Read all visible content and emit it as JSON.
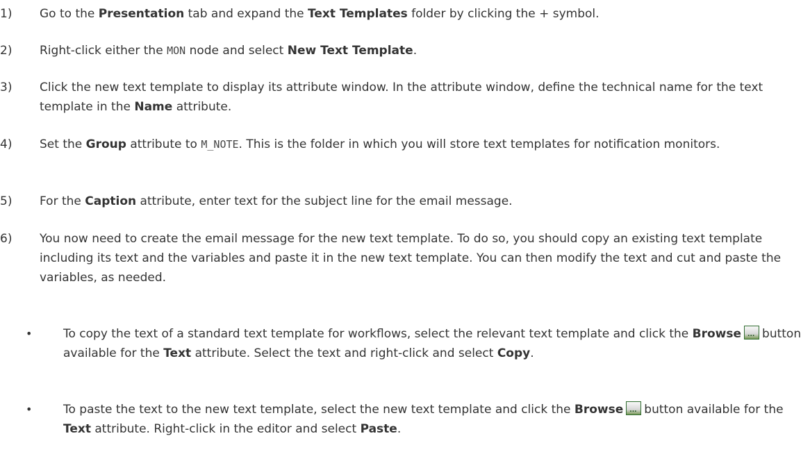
{
  "steps": [
    {
      "num": "1)",
      "parts": [
        {
          "t": "Go to the "
        },
        {
          "b": "Presentation"
        },
        {
          "t": " tab and expand the "
        },
        {
          "b": "Text Templates"
        },
        {
          "t": " folder by clicking the + symbol."
        }
      ]
    },
    {
      "num": "2)",
      "parts": [
        {
          "t": "Right-click either the "
        },
        {
          "m": "MON"
        },
        {
          "t": " node and select "
        },
        {
          "b": "New Text Template"
        },
        {
          "t": "."
        }
      ]
    },
    {
      "num": "3)",
      "parts": [
        {
          "t": "Click the new text template to display its attribute window. In the attribute window, define the technical name for the text template in the "
        },
        {
          "b": "Name"
        },
        {
          "t": " attribute."
        }
      ]
    },
    {
      "num": "4)",
      "parts": [
        {
          "t": "Set the "
        },
        {
          "b": "Group"
        },
        {
          "t": " attribute to "
        },
        {
          "m": "M_NOTE"
        },
        {
          "t": ". This is the folder in which you will store text templates for notification monitors."
        }
      ]
    },
    {
      "num": "5)",
      "parts": [
        {
          "t": "For the "
        },
        {
          "b": "Caption"
        },
        {
          "t": " attribute, enter text for the subject line for the email message."
        }
      ]
    },
    {
      "num": "6)",
      "parts": [
        {
          "t": "You now need to create the email message for the new text template. To do so, you should copy an existing text template including its text and the variables and paste it in the new text template. You can then modify the text and cut and paste the variables, as needed."
        }
      ]
    }
  ],
  "bullets": [
    {
      "dot": "•",
      "parts": [
        {
          "t": "To copy the text of a standard text template for workflows, select the relevant text template and click the "
        },
        {
          "b": "Browse"
        },
        {
          "icon": "browse-icon"
        },
        {
          "t": "button available for the "
        },
        {
          "b": "Text"
        },
        {
          "t": " attribute. Select the text and right-click and select "
        },
        {
          "b": "Copy"
        },
        {
          "t": "."
        }
      ]
    },
    {
      "dot": "•",
      "parts": [
        {
          "t": "To paste the text to the new text template, select the new text template and click the "
        },
        {
          "b": "Browse"
        },
        {
          "icon": "browse-icon"
        },
        {
          "t": "button available for the "
        },
        {
          "b": "Text"
        },
        {
          "t": " attribute. Right-click in the editor and select "
        },
        {
          "b": "Paste"
        },
        {
          "t": "."
        }
      ]
    }
  ]
}
